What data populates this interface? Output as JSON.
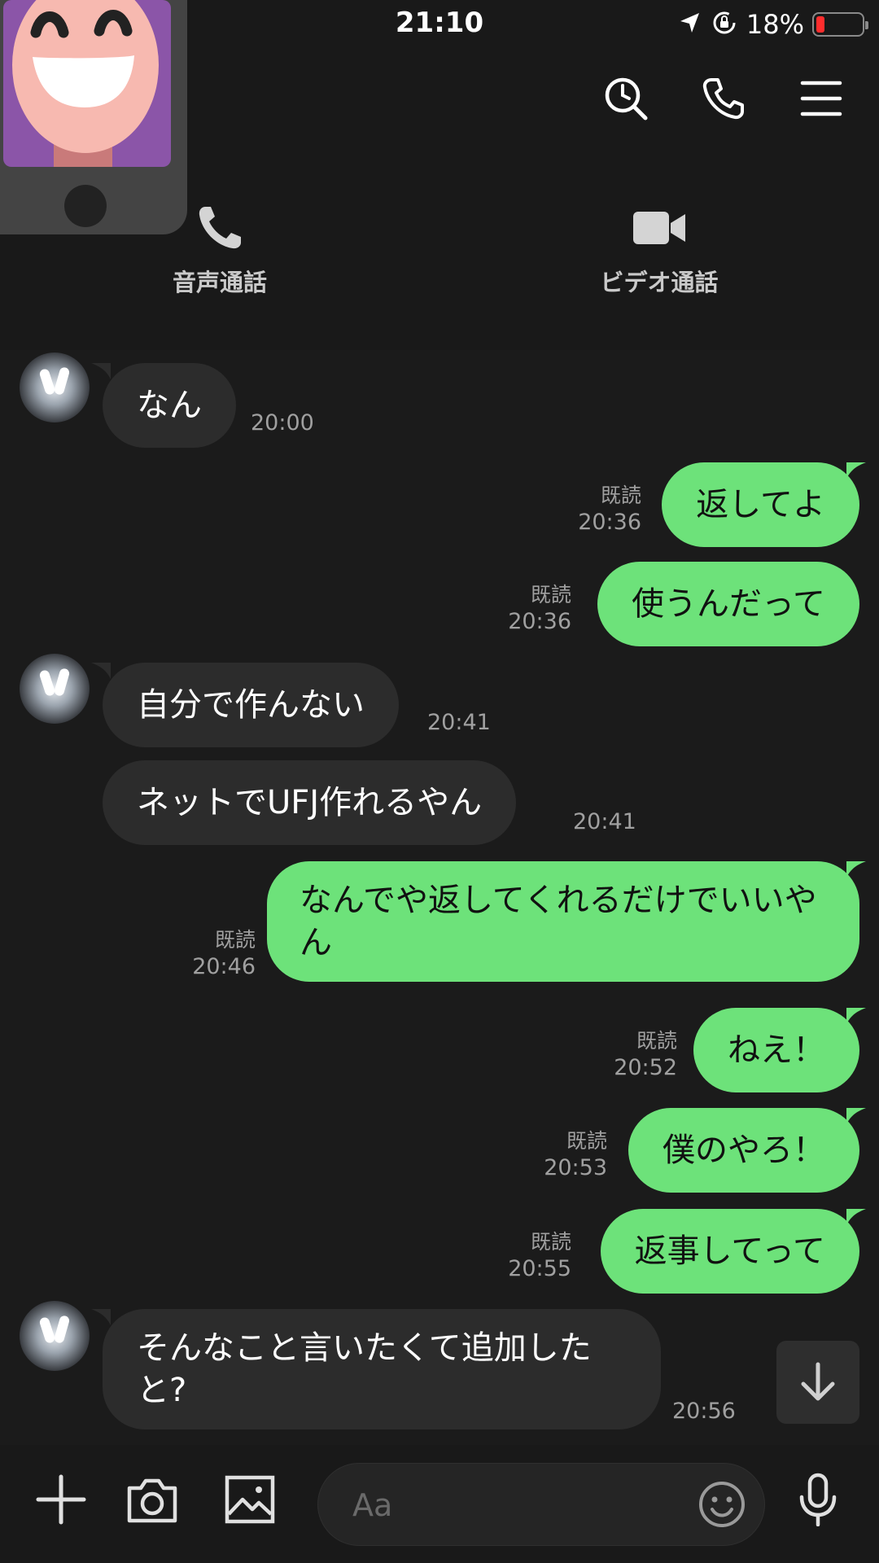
{
  "status_bar": {
    "time": "21:10",
    "battery_percent": "18%",
    "battery_level": 0.18,
    "battery_color": "#ff2d2d"
  },
  "header": {
    "icons": [
      "search-icon",
      "phone-icon",
      "menu-icon"
    ],
    "voice_call_label": "音声通話",
    "video_call_label": "ビデオ通話"
  },
  "messages": [
    {
      "dir": "in",
      "text": "なん",
      "time": "20:00"
    },
    {
      "dir": "out",
      "text": "返してよ",
      "read": "既読",
      "time": "20:36"
    },
    {
      "dir": "out",
      "text": "使うんだって",
      "read": "既読",
      "time": "20:36"
    },
    {
      "dir": "in",
      "text": "自分で作んない",
      "time": "20:41"
    },
    {
      "dir": "in",
      "text": "ネットでUFJ作れるやん",
      "time": "20:41"
    },
    {
      "dir": "out",
      "text": "なんでや返してくれるだけでいいやん",
      "read": "既読",
      "time": "20:46"
    },
    {
      "dir": "out",
      "text": "ねえ！",
      "read": "既読",
      "time": "20:52"
    },
    {
      "dir": "out",
      "text": "僕のやろ！",
      "read": "既読",
      "time": "20:53"
    },
    {
      "dir": "out",
      "text": "返事してって",
      "read": "既読",
      "time": "20:55"
    },
    {
      "dir": "in",
      "text": "そんなこと言いたくて追加したと?",
      "time": "20:56"
    }
  ],
  "input": {
    "placeholder": "Aa"
  },
  "colors": {
    "outgoing_bubble": "#6de27a",
    "incoming_bubble": "#2c2c2c",
    "background": "#1b1b1b"
  }
}
